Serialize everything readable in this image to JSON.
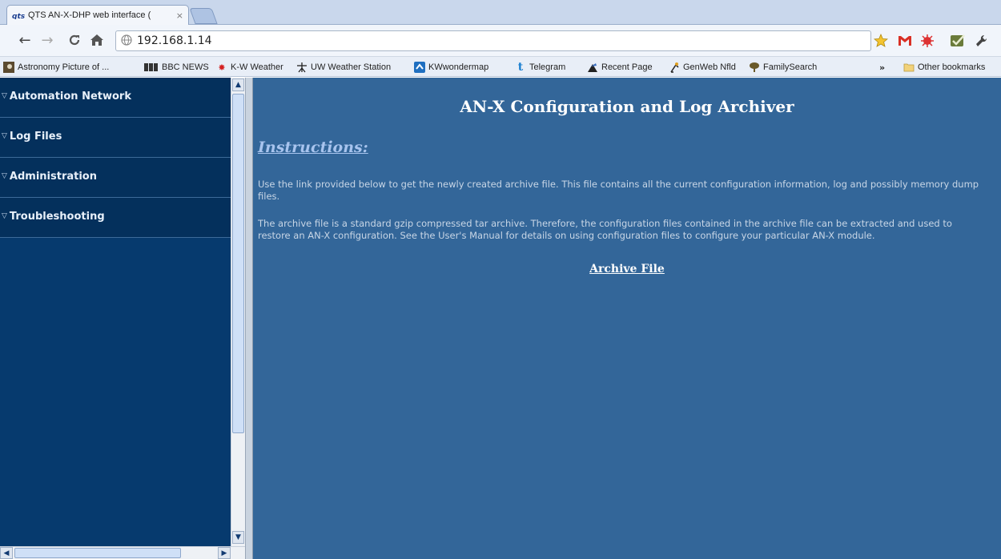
{
  "browser": {
    "tab_title": "QTS AN-X-DHP web interface (",
    "tab_close": "×",
    "url": "192.168.1.14"
  },
  "bookmarks": [
    {
      "label": "Astronomy Picture of ...",
      "icon": "astronomy-icon"
    },
    {
      "label": "BBC NEWS",
      "icon": "bbc-icon"
    },
    {
      "label": "K-W Weather",
      "icon": "maple-leaf-icon"
    },
    {
      "label": "UW Weather Station",
      "icon": "weather-station-icon"
    },
    {
      "label": "KWwondermap",
      "icon": "wondermap-icon"
    },
    {
      "label": "Telegram",
      "icon": "telegram-icon"
    },
    {
      "label": "Recent Page",
      "icon": "recent-page-icon"
    },
    {
      "label": "GenWeb Nfld",
      "icon": "genweb-icon"
    },
    {
      "label": "FamilySearch",
      "icon": "familysearch-icon"
    }
  ],
  "bookmarks_overflow": "»",
  "other_bookmarks": "Other bookmarks",
  "sidebar": {
    "items": [
      {
        "label": "Automation Network"
      },
      {
        "label": "Log Files"
      },
      {
        "label": "Administration"
      },
      {
        "label": "Troubleshooting"
      }
    ]
  },
  "main": {
    "title": "AN-X Configuration and Log Archiver",
    "instructions_heading": "Instructions:",
    "paragraph1": "Use the link provided below to get the newly created archive file. This file contains all the current configuration information, log and possibly memory dump files.",
    "paragraph2": "The archive file is a standard gzip compressed tar archive. Therefore, the configuration files contained in the archive file can be extracted and used to restore an AN-X configuration. See the User's Manual for details on using configuration files to configure your particular AN-X module.",
    "archive_link": "Archive File"
  },
  "colors": {
    "sidebar_bg": "#04305c",
    "main_bg": "#336699",
    "link": "#ffffff"
  }
}
